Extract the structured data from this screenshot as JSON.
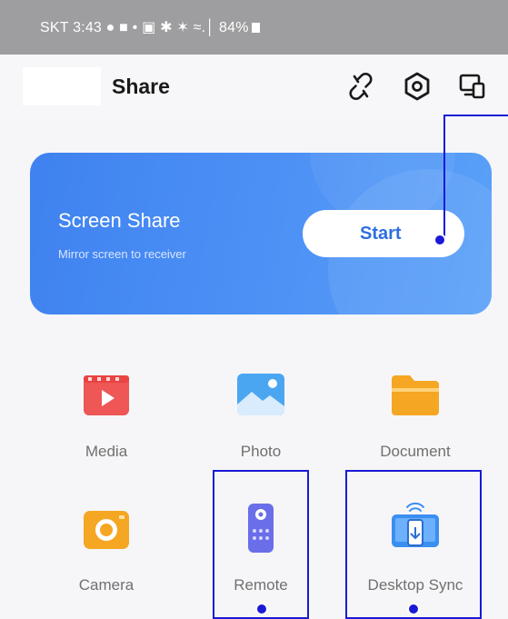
{
  "status_bar": {
    "text": "SKT 3:43 ● ■ •   ▣ ✱ ✶ ≈.│ 84%"
  },
  "header": {
    "title": "Share",
    "icons": [
      "link-off-icon",
      "settings-icon",
      "screen-mirror-icon"
    ]
  },
  "screen_share": {
    "title": "Screen Share",
    "subtitle": "Mirror screen to receiver",
    "start_label": "Start"
  },
  "features": [
    {
      "label": "Media",
      "icon": "media-video-icon"
    },
    {
      "label": "Photo",
      "icon": "photo-icon"
    },
    {
      "label": "Document",
      "icon": "folder-icon"
    },
    {
      "label": "Camera",
      "icon": "camera-icon"
    },
    {
      "label": "Remote",
      "icon": "remote-control-icon"
    },
    {
      "label": "Desktop Sync",
      "icon": "desktop-sync-icon"
    }
  ],
  "colors": {
    "accent": "#3f82f0",
    "annotation": "#1a1ad6",
    "media": "#ef5656",
    "photo": "#4ba6f2",
    "document": "#f5a623",
    "camera": "#f5a623",
    "remote": "#6a6ee8",
    "desktop_sync": "#3b8ff0"
  }
}
